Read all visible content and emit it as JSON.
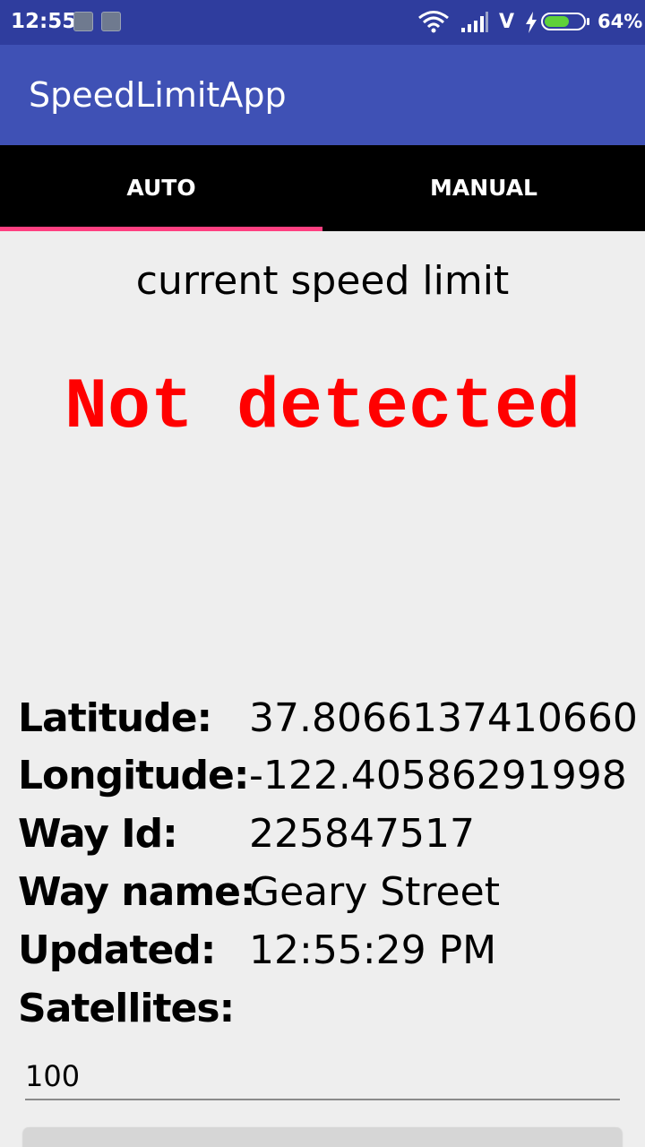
{
  "status_bar": {
    "time": "12:55",
    "network": "V",
    "battery_percent": "64%",
    "battery_level": 0.64,
    "icons": [
      "notification-app-icon",
      "notification-app-icon",
      "wifi-icon",
      "signal-icon",
      "charging-bolt-icon",
      "battery-icon"
    ]
  },
  "app_bar": {
    "title": "SpeedLimitApp",
    "color": "#3f51b5"
  },
  "tabs": [
    {
      "label": "AUTO",
      "selected": true
    },
    {
      "label": "MANUAL",
      "selected": false
    }
  ],
  "tab_indicator_color": "#ff4081",
  "speed": {
    "caption": "current speed limit",
    "value": "Not detected",
    "value_color": "#ff0000"
  },
  "info": {
    "latitude": {
      "label": "Latitude:",
      "value": "37.8066137410660"
    },
    "longitude": {
      "label": "Longitude:",
      "value": "-122.40586291998"
    },
    "way_id": {
      "label": "Way Id:",
      "value": "225847517"
    },
    "way_name": {
      "label": "Way name:",
      "value": "Geary Street"
    },
    "updated": {
      "label": "Updated:",
      "value": "12:55:29 PM"
    },
    "satellites": {
      "label": "Satellites:",
      "value": ""
    }
  },
  "manual_input": {
    "value": "100"
  }
}
